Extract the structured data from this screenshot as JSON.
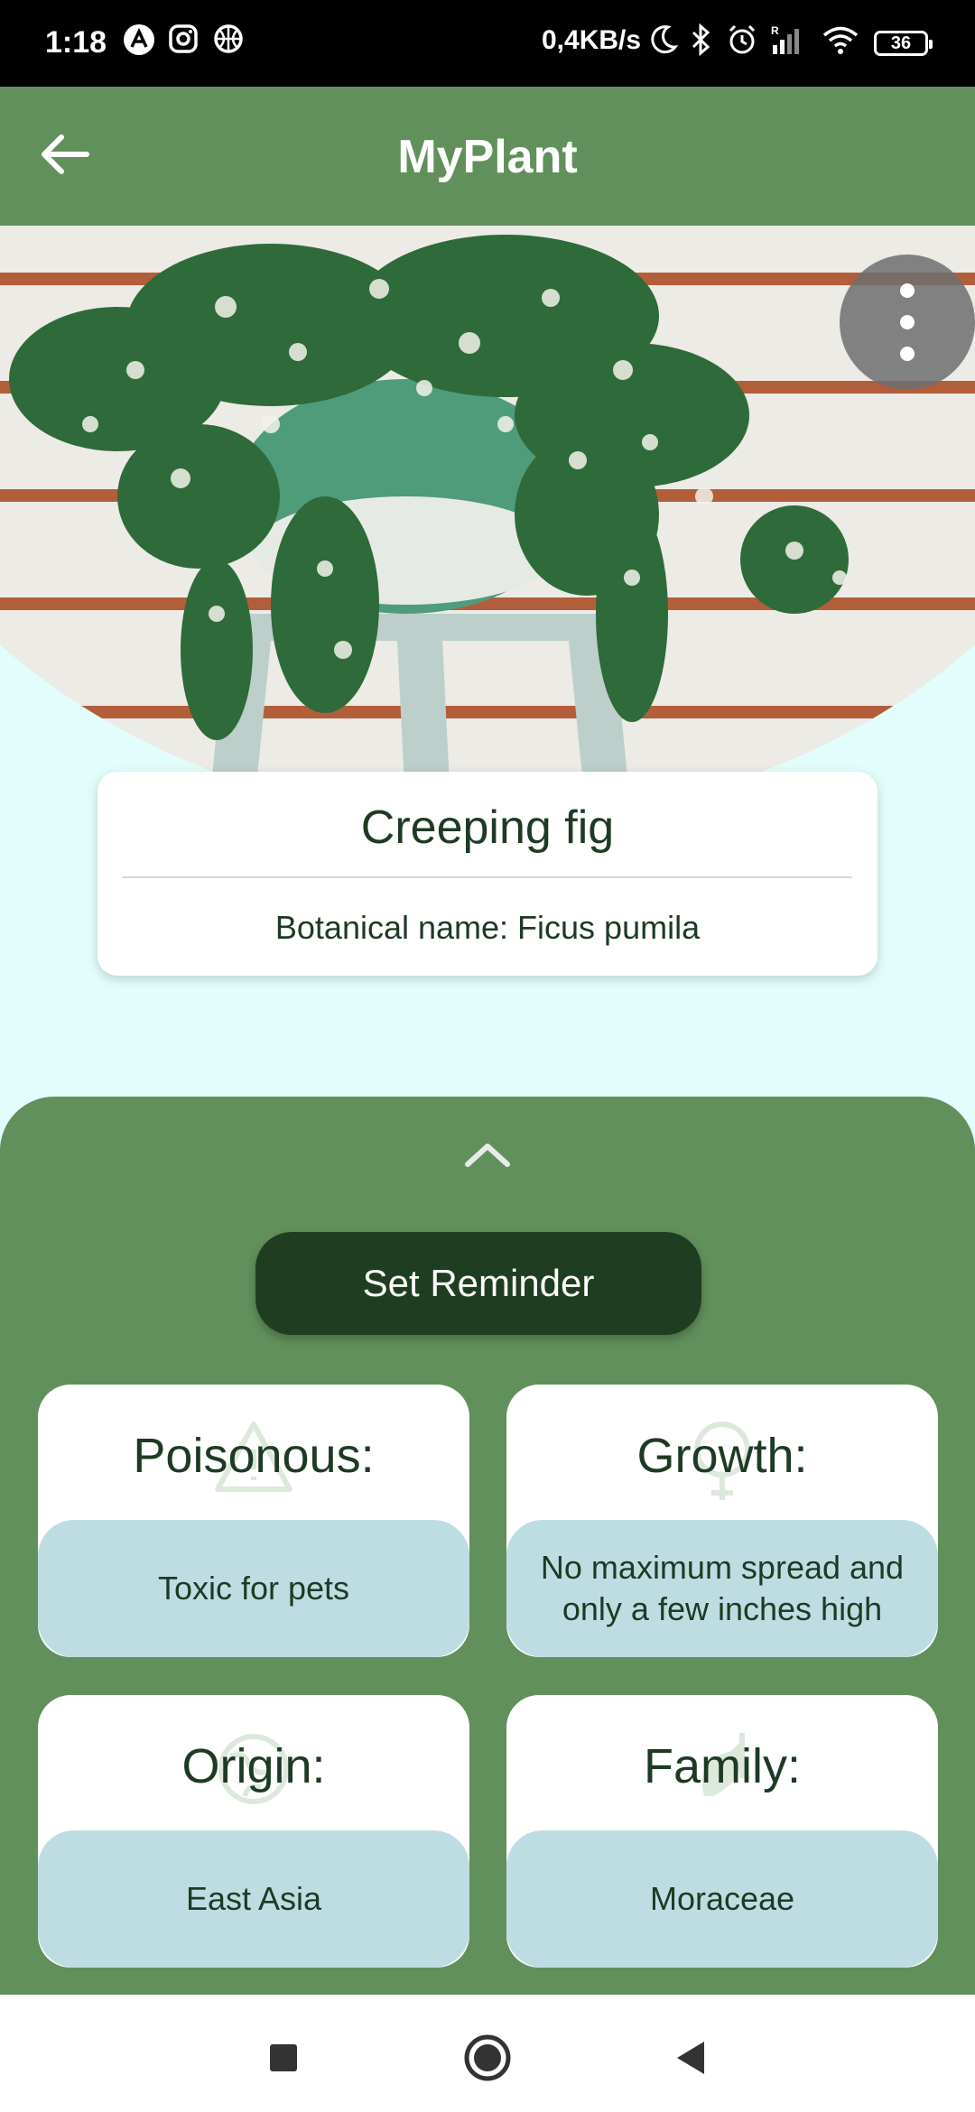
{
  "status_bar": {
    "time": "1:18",
    "network_speed": "0,4KB/s",
    "battery": "36",
    "icons": [
      "a-icon",
      "instagram-icon",
      "basketball-icon",
      "moon-icon",
      "bluetooth-icon",
      "alarm-icon",
      "signal-icon",
      "wifi-icon",
      "battery-icon"
    ]
  },
  "app_bar": {
    "title": "MyPlant",
    "back_icon": "arrow-left-icon"
  },
  "plant": {
    "common_name": "Creeping fig",
    "botanical_name": "Botanical name: Ficus pumila"
  },
  "sheet": {
    "expand_icon": "chevron-up-icon",
    "reminder_label": "Set Reminder",
    "cards": [
      {
        "title": "Poisonous:",
        "value": "Toxic for pets",
        "icon": "warning-icon"
      },
      {
        "title": "Growth:",
        "value": "No maximum spread and only a few inches high",
        "icon": "tree-icon"
      },
      {
        "title": "Origin:",
        "value": "East Asia",
        "icon": "globe-icon"
      },
      {
        "title": "Family:",
        "value": "Moraceae",
        "icon": "leaf-icon"
      }
    ]
  },
  "colors": {
    "primary_green": "#62905c",
    "dark_green": "#1f3e21",
    "text_dark": "#1e3a24",
    "value_bg": "#bedde3",
    "page_bg": "#e3fdfc"
  },
  "nav": {
    "icons": [
      "recents-square-icon",
      "home-circle-icon",
      "back-triangle-icon"
    ]
  }
}
